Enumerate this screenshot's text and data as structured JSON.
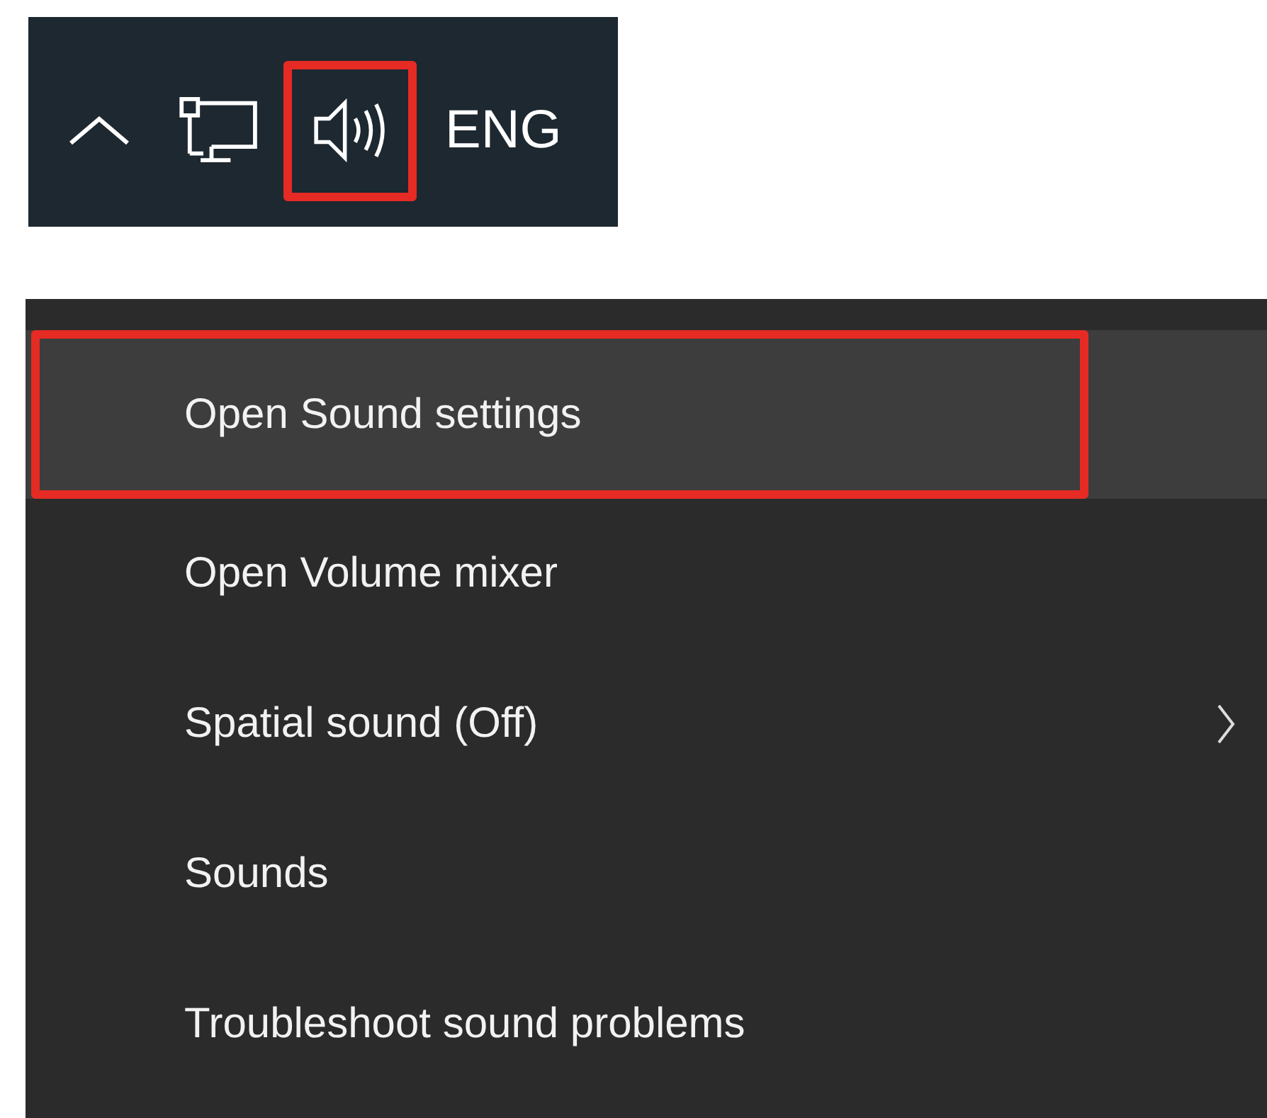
{
  "tray": {
    "language": "ENG",
    "speaker_annotated": true
  },
  "menu": {
    "items": [
      {
        "label": "Open Sound settings",
        "selected": true,
        "annotated": true,
        "has_submenu": false
      },
      {
        "label": "Open Volume mixer",
        "selected": false,
        "annotated": false,
        "has_submenu": false
      },
      {
        "label": "Spatial sound (Off)",
        "selected": false,
        "annotated": false,
        "has_submenu": true
      },
      {
        "label": "Sounds",
        "selected": false,
        "annotated": false,
        "has_submenu": false
      },
      {
        "label": "Troubleshoot sound problems",
        "selected": false,
        "annotated": false,
        "has_submenu": false
      }
    ]
  }
}
